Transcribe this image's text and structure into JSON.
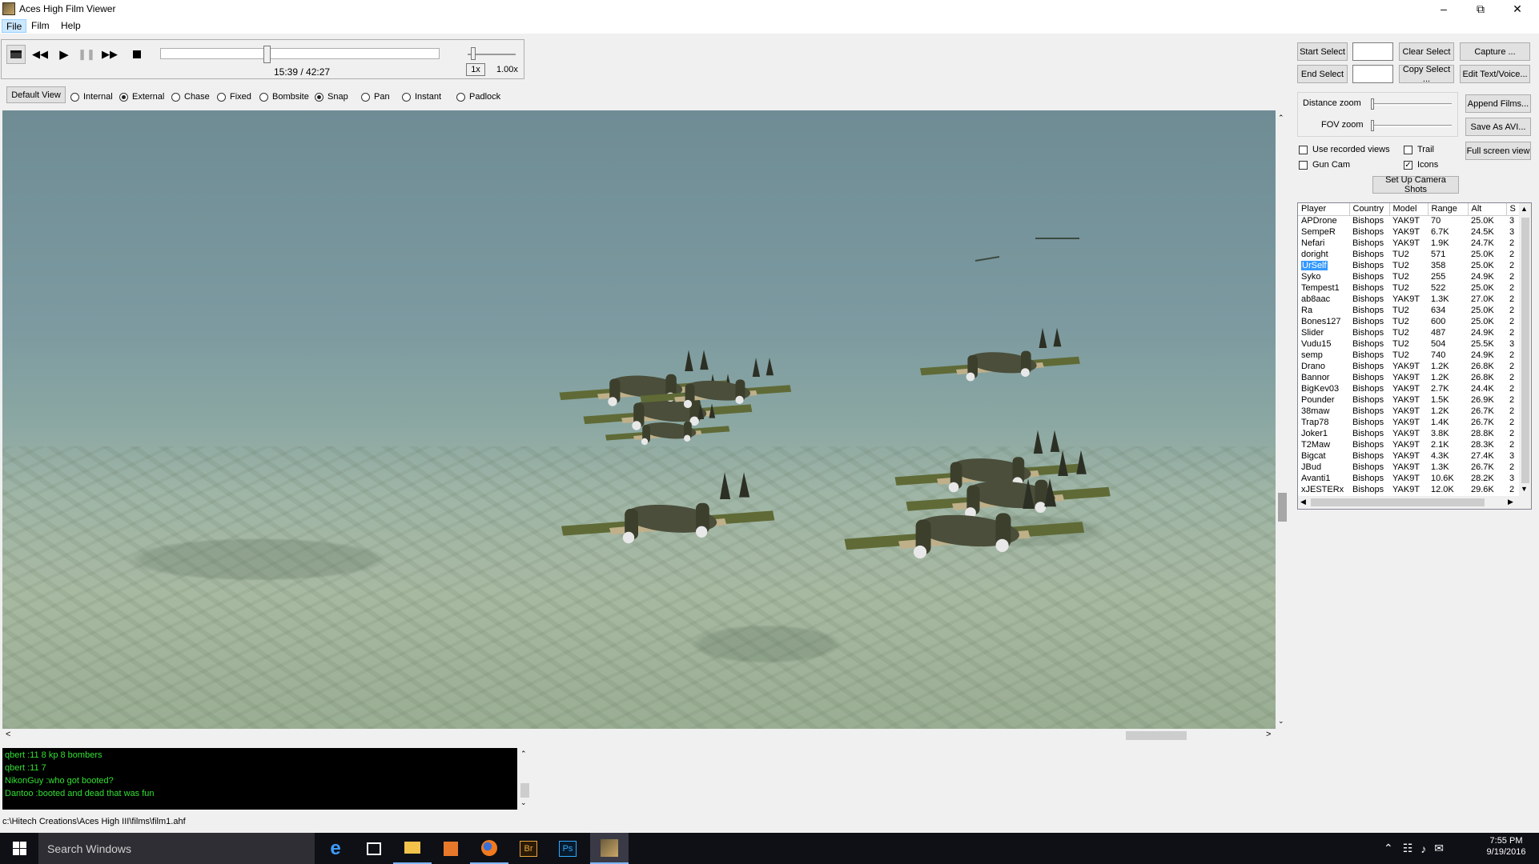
{
  "window": {
    "title": "Aces High Film Viewer"
  },
  "menu": [
    "File",
    "Film",
    "Help"
  ],
  "playback": {
    "time": "15:39 / 42:27",
    "speed_button": "1x",
    "speed_value": "1.00x",
    "position_fraction": 0.369
  },
  "view": {
    "default_button": "Default View",
    "options": [
      {
        "label": "Internal",
        "selected": false
      },
      {
        "label": "External",
        "selected": true
      },
      {
        "label": "Chase",
        "selected": false
      },
      {
        "label": "Fixed",
        "selected": false
      },
      {
        "label": "Bombsite",
        "selected": false
      },
      {
        "label": "Snap",
        "selected": true
      },
      {
        "label": "Pan",
        "selected": false
      },
      {
        "label": "Instant",
        "selected": false
      },
      {
        "label": "Padlock",
        "selected": false
      }
    ]
  },
  "right_panel": {
    "start_select": "Start Select",
    "end_select": "End Select",
    "clear_select": "Clear Select",
    "copy_select": "Copy Select ...",
    "capture": "Capture ...",
    "edit_text": "Edit Text/Voice...",
    "distance_zoom": "Distance zoom",
    "fov_zoom": "FOV zoom",
    "append_films": "Append Films...",
    "save_avi": "Save As AVI...",
    "full_screen": "Full screen view",
    "use_recorded_views": "Use recorded views",
    "gun_cam": "Gun Cam",
    "trail": "Trail",
    "icons": "Icons",
    "setup_camera": "Set Up Camera Shots"
  },
  "players": {
    "columns": [
      "Player",
      "Country",
      "Model",
      "Range",
      "Alt",
      "S"
    ],
    "rows": [
      [
        "APDrone",
        "Bishops",
        "YAK9T",
        "70",
        "25.0K",
        "3"
      ],
      [
        "SempeR",
        "Bishops",
        "YAK9T",
        "6.7K",
        "24.5K",
        "3"
      ],
      [
        "Nefari",
        "Bishops",
        "YAK9T",
        "1.9K",
        "24.7K",
        "2"
      ],
      [
        "doright",
        "Bishops",
        "TU2",
        "571",
        "25.0K",
        "2"
      ],
      [
        "UrSelf",
        "Bishops",
        "TU2",
        "358",
        "25.0K",
        "2"
      ],
      [
        "Syko",
        "Bishops",
        "TU2",
        "255",
        "24.9K",
        "2"
      ],
      [
        "Tempest1",
        "Bishops",
        "TU2",
        "522",
        "25.0K",
        "2"
      ],
      [
        "ab8aac",
        "Bishops",
        "YAK9T",
        "1.3K",
        "27.0K",
        "2"
      ],
      [
        "Ra",
        "Bishops",
        "TU2",
        "634",
        "25.0K",
        "2"
      ],
      [
        "Bones127",
        "Bishops",
        "TU2",
        "600",
        "25.0K",
        "2"
      ],
      [
        "Slider",
        "Bishops",
        "TU2",
        "487",
        "24.9K",
        "2"
      ],
      [
        "Vudu15",
        "Bishops",
        "TU2",
        "504",
        "25.5K",
        "3"
      ],
      [
        "semp",
        "Bishops",
        "TU2",
        "740",
        "24.9K",
        "2"
      ],
      [
        "Drano",
        "Bishops",
        "YAK9T",
        "1.2K",
        "26.8K",
        "2"
      ],
      [
        "Bannor",
        "Bishops",
        "YAK9T",
        "1.2K",
        "26.8K",
        "2"
      ],
      [
        "BigKev03",
        "Bishops",
        "YAK9T",
        "2.7K",
        "24.4K",
        "2"
      ],
      [
        "Pounder",
        "Bishops",
        "YAK9T",
        "1.5K",
        "26.9K",
        "2"
      ],
      [
        "38maw",
        "Bishops",
        "YAK9T",
        "1.2K",
        "26.7K",
        "2"
      ],
      [
        "Trap78",
        "Bishops",
        "YAK9T",
        "1.4K",
        "26.7K",
        "2"
      ],
      [
        "Joker1",
        "Bishops",
        "YAK9T",
        "3.8K",
        "28.8K",
        "2"
      ],
      [
        "T2Maw",
        "Bishops",
        "YAK9T",
        "2.1K",
        "28.3K",
        "2"
      ],
      [
        "Bigcat",
        "Bishops",
        "YAK9T",
        "4.3K",
        "27.4K",
        "3"
      ],
      [
        "JBud",
        "Bishops",
        "YAK9T",
        "1.3K",
        "26.7K",
        "2"
      ],
      [
        "Avanti1",
        "Bishops",
        "YAK9T",
        "10.6K",
        "28.2K",
        "3"
      ],
      [
        "xJESTERx",
        "Bishops",
        "YAK9T",
        "12.0K",
        "29.6K",
        "2"
      ]
    ],
    "selected_player": "UrSelf"
  },
  "chat": [
    "qbert :11 8 kp 8 bombers",
    "qbert :11 7",
    "NikonGuy :who got booted?",
    "Dantoo :booted and dead  that was fun"
  ],
  "status_path": "c:\\Hitech Creations\\Aces High III\\films\\film1.ahf",
  "taskbar": {
    "search_placeholder": "Search Windows",
    "time": "7:55 PM",
    "date": "9/19/2016"
  }
}
